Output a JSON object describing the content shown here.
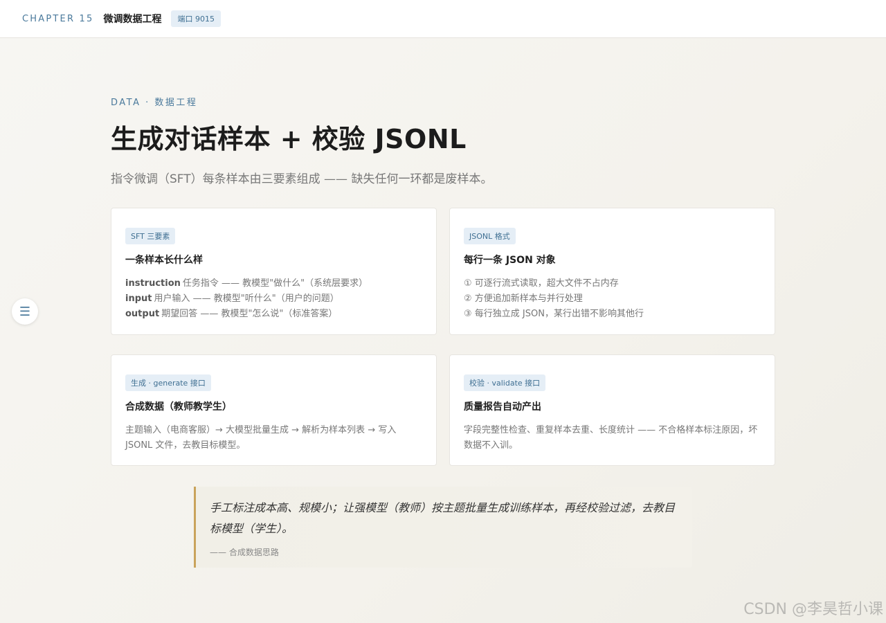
{
  "topbar": {
    "chapter": "CHAPTER 15",
    "title": "微调数据工程",
    "port": "端口 9015"
  },
  "menu": {
    "icon": "menu-icon",
    "glyph": "☰"
  },
  "hero": {
    "eyebrow": "DATA · 数据工程",
    "title": "生成对话样本 + 校验 JSONL",
    "subtitle": "指令微调（SFT）每条样本由三要素组成 —— 缺失任何一环都是废样本。"
  },
  "cards": [
    {
      "tag": "SFT 三要素",
      "title": "一条样本长什么样",
      "lines": [
        {
          "key": "instruction",
          "text": "任务指令 —— 教模型\"做什么\"（系统层要求）"
        },
        {
          "key": "input",
          "text": "用户输入 —— 教模型\"听什么\"（用户的问题）"
        },
        {
          "key": "output",
          "text": "期望回答 —— 教模型\"怎么说\"（标准答案）"
        }
      ]
    },
    {
      "tag": "JSONL 格式",
      "title": "每行一条 JSON 对象",
      "lines": [
        "① 可逐行流式读取，超大文件不占内存",
        "② 方便追加新样本与并行处理",
        "③ 每行独立成 JSON，某行出错不影响其他行"
      ]
    },
    {
      "tag": "生成 · generate 接口",
      "title": "合成数据（教师教学生）",
      "desc": "主题输入（电商客服）→ 大模型批量生成 → 解析为样本列表 → 写入 JSONL 文件，去教目标模型。"
    },
    {
      "tag": "校验 · validate 接口",
      "title": "质量报告自动产出",
      "desc": "字段完整性检查、重复样本去重、长度统计 —— 不合格样本标注原因，坏数据不入训。"
    }
  ],
  "quote": {
    "text": "手工标注成本高、规模小；让强模型（教师）按主题批量生成训练样本，再经校验过滤，去教目标模型（学生）。",
    "cite": "—— 合成数据思路"
  },
  "watermark": "CSDN @李昊哲小课",
  "colors": {
    "accent": "#4b7a9c",
    "tag_bg": "#e5eef6",
    "quote_border": "#c9a35b"
  }
}
